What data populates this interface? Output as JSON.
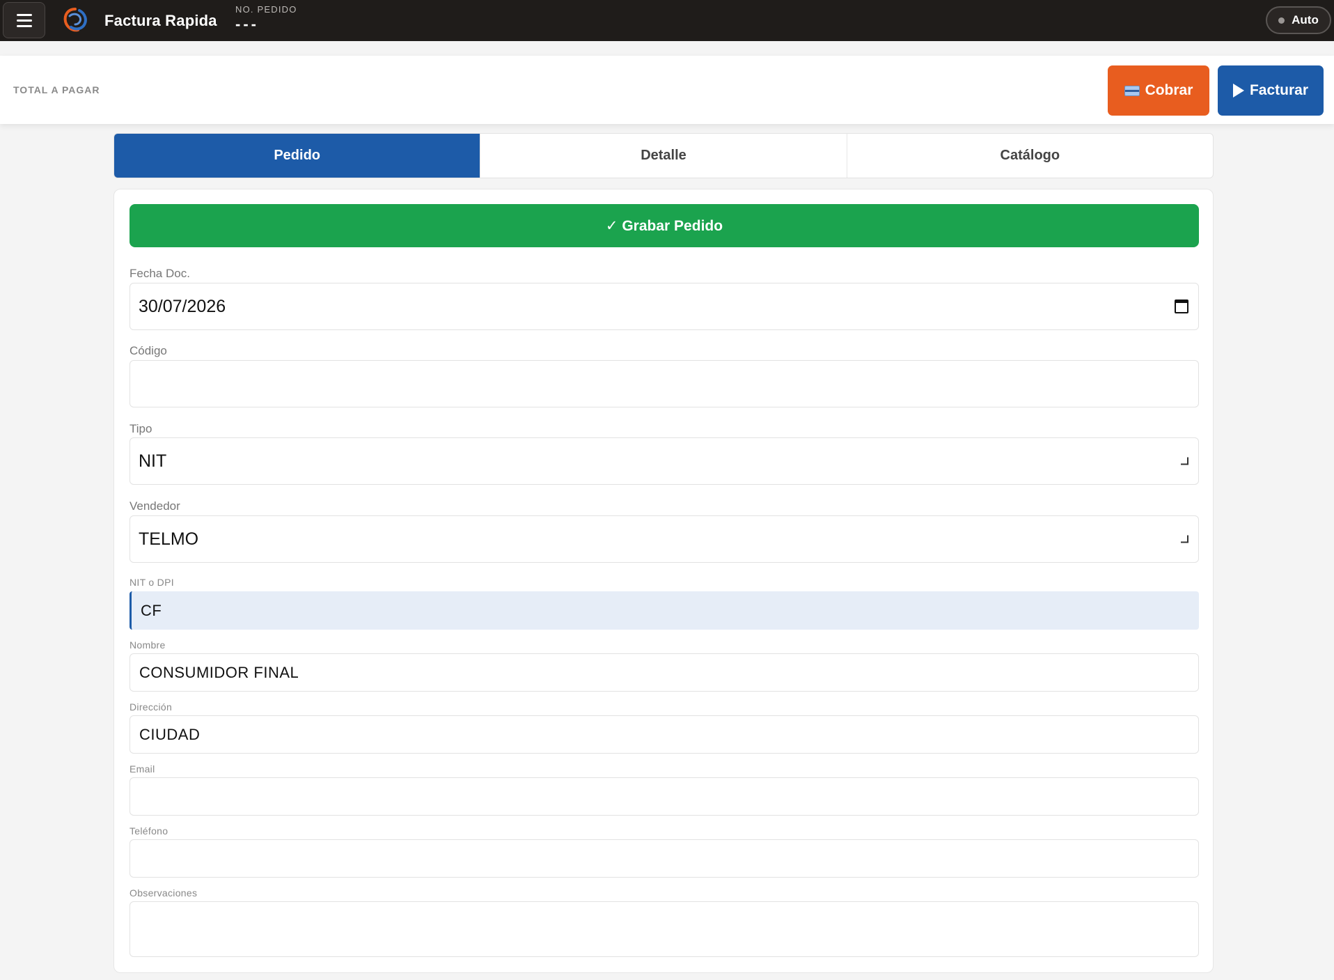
{
  "topbar": {
    "app_title": "Factura Rapida",
    "order_label": "NO. PEDIDO",
    "order_value": "---",
    "theme_label": "Auto"
  },
  "totalbar": {
    "total_label": "TOTAL A PAGAR",
    "cobrar_label": "Cobrar",
    "facturar_label": "Facturar"
  },
  "tabs": [
    {
      "label": "Pedido",
      "active": true
    },
    {
      "label": "Detalle",
      "active": false
    },
    {
      "label": "Catálogo",
      "active": false
    }
  ],
  "form": {
    "save_label": "✓ Grabar Pedido",
    "fecha_label": "Fecha Doc.",
    "fecha_value": "30/07/2026",
    "codigo_label": "Código",
    "codigo_value": "",
    "tipo_label": "Tipo",
    "tipo_value": "NIT",
    "vendedor_label": "Vendedor",
    "vendedor_value": "TELMO",
    "nit_label": "NIT o DPI",
    "nit_value": "CF",
    "nombre_label": "Nombre",
    "nombre_value": "CONSUMIDOR FINAL",
    "direccion_label": "Dirección",
    "direccion_value": "CIUDAD",
    "email_label": "Email",
    "email_value": "",
    "telefono_label": "Teléfono",
    "telefono_value": "",
    "observaciones_label": "Observaciones",
    "observaciones_value": ""
  },
  "colors": {
    "topbar": "#1f1c1a",
    "primary_blue": "#1d5ba8",
    "cobrar_orange": "#e85d1f",
    "save_green": "#1ba34e"
  },
  "icons": [
    "menu-icon",
    "app-logo-icon",
    "credit-card-icon",
    "play-icon",
    "calendar-icon",
    "chevron-down-icon"
  ]
}
